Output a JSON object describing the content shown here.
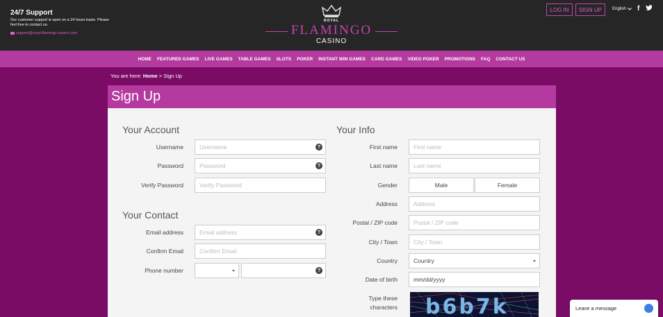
{
  "header": {
    "support_title": "24/7 Support",
    "support_text": "Our customer support is open on a 24 hours basis. Please feel free to contact us.",
    "support_email": "support@royal-flamingo-casino.com",
    "logo_royal": "ROYAL",
    "logo_flamingo": "FLAMINGO",
    "logo_casino": "CASINO",
    "login_label": "LOG IN",
    "signup_label": "SIGN UP",
    "language": "English",
    "facebook_glyph": "f"
  },
  "nav": [
    "HOME",
    "FEATURED GAMES",
    "LIVE GAMES",
    "TABLE GAMES",
    "SLOTS",
    "POKER",
    "INSTANT WIN GAMES",
    "CARD GAMES",
    "VIDEO POKER",
    "PROMOTIONS",
    "FAQ",
    "CONTACT US"
  ],
  "breadcrumb": {
    "prefix": "You are here:",
    "home": "Home",
    "sep": ">",
    "current": "Sign Up"
  },
  "page_title": "Sign Up",
  "account": {
    "title": "Your Account",
    "username_label": "Username",
    "username_ph": "Username",
    "password_label": "Password",
    "password_ph": "Password",
    "verify_label": "Verify Password",
    "verify_ph": "Verify Password"
  },
  "contact": {
    "title": "Your Contact",
    "email_label": "Email address",
    "email_ph": "Email address",
    "confirm_label": "Confirm Email",
    "confirm_ph": "Confirm Email",
    "phone_label": "Phone number"
  },
  "info": {
    "title": "Your Info",
    "first_label": "First name",
    "first_ph": "First name",
    "last_label": "Last name",
    "last_ph": "Last name",
    "gender_label": "Gender",
    "male": "Male",
    "female": "Female",
    "address_label": "Address",
    "address_ph": "Address",
    "postal_label": "Postal / ZIP code",
    "postal_ph": "Postal / ZIP code",
    "city_label": "City / Town",
    "city_ph": "City / Town",
    "country_label": "Country",
    "country_value": "Country",
    "dob_label": "Date of birth",
    "dob_value": "mm/dd/yyyy",
    "captcha_label_1": "Type these",
    "captcha_label_2": "characters",
    "captcha_text": "b6b7k"
  },
  "help_glyph": "?",
  "chat": {
    "label": "Leave a message"
  },
  "colors": {
    "brand_pink": "#b43aa0",
    "page_bg": "#7a0c66",
    "header_bg": "#262626"
  }
}
